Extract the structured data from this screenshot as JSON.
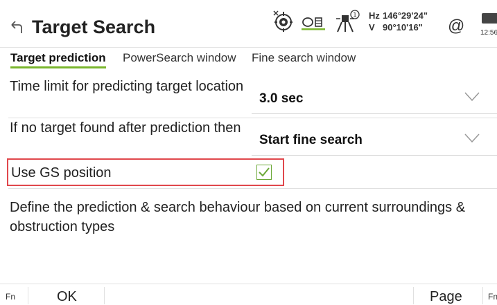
{
  "header": {
    "title": "Target Search",
    "back_icon": "back-arrow-icon",
    "angles": {
      "hz_label": "Hz",
      "hz_value": "146°29'24\"",
      "v_label": "V",
      "v_value": "90°10'16\""
    },
    "at_symbol": "@",
    "time": "12:56"
  },
  "tabs": [
    {
      "label": "Target prediction",
      "active": true
    },
    {
      "label": "PowerSearch window",
      "active": false
    },
    {
      "label": "Fine search window",
      "active": false
    }
  ],
  "fields": {
    "time_limit": {
      "label": "Time limit for predicting target location",
      "value": "3.0 sec"
    },
    "no_target": {
      "label": "If no target found after prediction then",
      "value": "Start fine search"
    },
    "gs_position": {
      "label": "Use GS position",
      "checked": true
    }
  },
  "description": "Define the prediction & search behaviour based on current surroundings & obstruction types",
  "softkeys": {
    "fn_left": "Fn",
    "ok": "OK",
    "page": "Page",
    "fn_right": "Fn"
  },
  "colors": {
    "accent_green": "#79b52c",
    "highlight_red": "#e0474c",
    "check_green": "#6aa836"
  }
}
